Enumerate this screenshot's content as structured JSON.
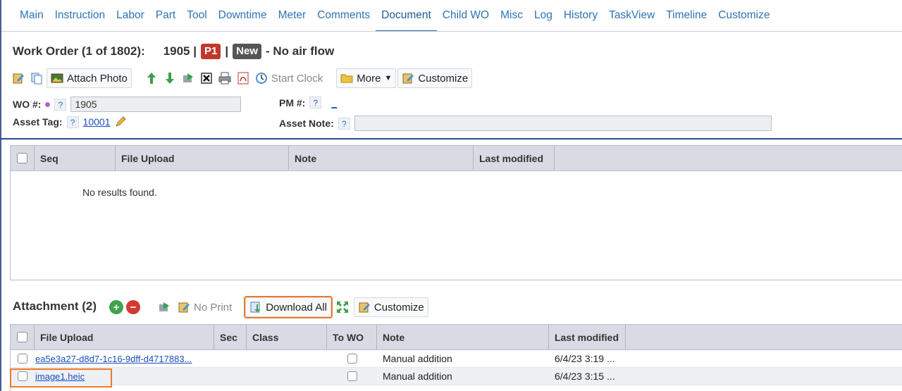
{
  "tabs": [
    "Main",
    "Instruction",
    "Labor",
    "Part",
    "Tool",
    "Downtime",
    "Meter",
    "Comments",
    "Document",
    "Child WO",
    "Misc",
    "Log",
    "History",
    "TaskView",
    "Timeline",
    "Customize"
  ],
  "active_tab": "Document",
  "header": {
    "title": "Work Order (1 of 1802):",
    "wo_number": "1905 |",
    "priority": "P1",
    "sep": "|",
    "status": "New",
    "description": "- No air flow"
  },
  "toolbar": {
    "attach_photo": "Attach Photo",
    "start_clock": "Start Clock",
    "more": "More",
    "customize": "Customize"
  },
  "form": {
    "wo_label": "WO #:",
    "wo_value": "1905",
    "pm_label": "PM #:",
    "pm_value": "_",
    "asset_tag_label": "Asset Tag:",
    "asset_tag_value": "10001",
    "asset_note_label": "Asset Note:",
    "asset_note_value": "",
    "help": "?"
  },
  "documents_grid": {
    "columns": [
      "Seq",
      "File Upload",
      "Note",
      "Last modified"
    ],
    "empty_text": "No results found."
  },
  "attachment": {
    "title": "Attachment (2)",
    "add": "+",
    "remove": "−",
    "no_print": "No Print",
    "download_all": "Download All",
    "customize": "Customize",
    "columns": [
      "File Upload",
      "Sec",
      "Class",
      "To WO",
      "Note",
      "Last modified"
    ],
    "rows": [
      {
        "file": "ea5e3a27-d8d7-1c16-9dff-d4717883...",
        "sec": "",
        "class": "",
        "note": "Manual addition",
        "modified": "6/4/23 3:19 ..."
      },
      {
        "file": "image1.heic",
        "sec": "",
        "class": "",
        "note": "Manual addition",
        "modified": "6/4/23 3:15 ..."
      }
    ]
  },
  "colors": {
    "tab_text": "#2f73b5",
    "priority": "#c0392b",
    "status": "#555555",
    "highlight": "#ec7a2a",
    "header_bg": "#d8dbe3"
  }
}
